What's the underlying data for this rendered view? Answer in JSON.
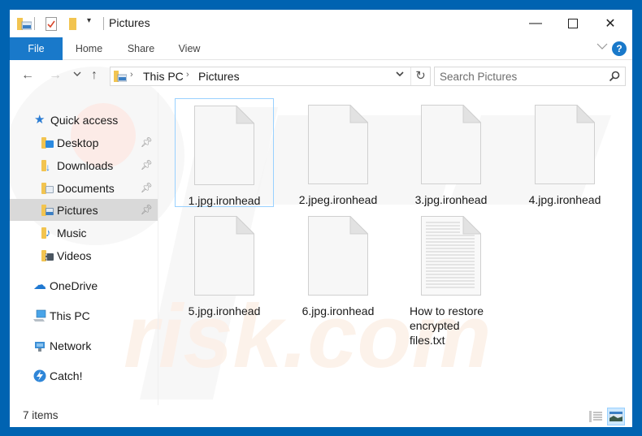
{
  "window": {
    "title": "Pictures",
    "controls": {
      "minimize": "—",
      "maximize": "☐",
      "close": "✕"
    }
  },
  "ribbon": {
    "tabs": [
      {
        "label": "File",
        "active": true
      },
      {
        "label": "Home"
      },
      {
        "label": "Share"
      },
      {
        "label": "View"
      }
    ],
    "expand_icon": "chevron-down-icon",
    "help_label": "?"
  },
  "navigation": {
    "back": "←",
    "forward": "→",
    "recent": "⌄",
    "up": "↑",
    "breadcrumb": [
      "This PC",
      "Pictures"
    ],
    "dropdown": "⌄",
    "refresh": "↻"
  },
  "search": {
    "placeholder": "Search Pictures",
    "value": ""
  },
  "sidebar": {
    "quick_access": {
      "label": "Quick access",
      "items": [
        {
          "label": "Desktop",
          "pinned": true
        },
        {
          "label": "Downloads",
          "pinned": true
        },
        {
          "label": "Documents",
          "pinned": true
        },
        {
          "label": "Pictures",
          "pinned": true,
          "selected": true
        },
        {
          "label": "Music",
          "pinned": false
        },
        {
          "label": "Videos",
          "pinned": false
        }
      ]
    },
    "locations": [
      {
        "label": "OneDrive"
      },
      {
        "label": "This PC"
      },
      {
        "label": "Network"
      },
      {
        "label": "Catch!"
      }
    ]
  },
  "files": [
    {
      "name": "1.jpg.ironhead",
      "type": "blank",
      "selected": true
    },
    {
      "name": "2.jpeg.ironhead",
      "type": "blank"
    },
    {
      "name": "3.jpg.ironhead",
      "type": "blank"
    },
    {
      "name": "4.jpg.ironhead",
      "type": "blank"
    },
    {
      "name": "5.jpg.ironhead",
      "type": "blank"
    },
    {
      "name": "6.jpg.ironhead",
      "type": "blank"
    },
    {
      "name_lines": [
        "How to restore",
        "encrypted",
        "files.txt"
      ],
      "name": "How to restore encrypted files.txt",
      "type": "text"
    }
  ],
  "status": {
    "item_count": "7 items"
  },
  "colors": {
    "accent": "#1979ca",
    "frame": "#0063b1",
    "selection": "#cce8ff",
    "folder": "#f2c450"
  }
}
